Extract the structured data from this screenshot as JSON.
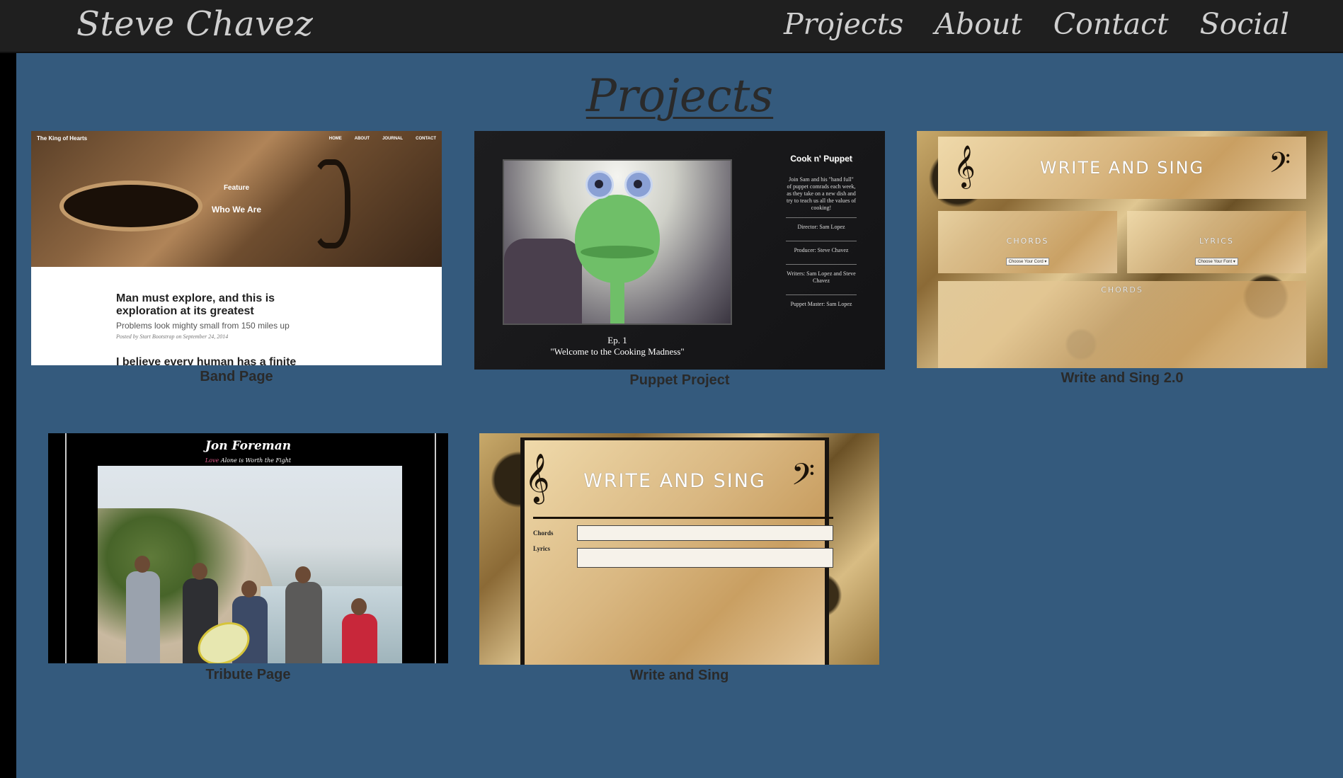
{
  "header": {
    "brand": "Steve Chavez",
    "nav": [
      "Projects",
      "About",
      "Contact",
      "Social"
    ]
  },
  "main": {
    "title": "Projects"
  },
  "projects": [
    {
      "caption": "Band Page",
      "site_title": "The King of Hearts",
      "site_nav": [
        "HOME",
        "ABOUT",
        "JOURNAL",
        "CONTACT"
      ],
      "hero_small": "Feature",
      "hero_large": "Who We Are",
      "headline": "Man must explore, and this is exploration at its greatest",
      "subline": "Problems look mighty small from 150 miles up",
      "meta": "Posted by Start Bootstrap on September 24, 2014",
      "cut_text": "I believe every human has a finite"
    },
    {
      "caption": "Puppet Project",
      "logo": "Cook n' Puppet",
      "blurb": "Join Sam and his \"hand full\" of puppet comrads each week, as they take on a new dish and try to teach us all the values of cooking!",
      "credits": [
        "Director: Sam Lopez",
        "Producer: Steve Chavez",
        "Writers: Sam Lopez and Steve Chavez",
        "Puppet Master: Sam Lopez"
      ],
      "episode": "Ep. 1",
      "episode_title": "\"Welcome to the Cooking Madness\""
    },
    {
      "caption": "Write and Sing 2.0",
      "title": "WRITE AND SING",
      "panels": [
        "CHORDS",
        "LYRICS"
      ],
      "select_chords": "Choose Your Cord ▾",
      "select_lyrics": "Choose Your Font ▾",
      "bottom_panel": "CHORDS"
    },
    {
      "caption": "Tribute Page",
      "name": "Jon Foreman",
      "tagline_love": "Love",
      "tagline_rest": "Alone is Worth the Fight"
    },
    {
      "caption": "Write and Sing",
      "title": "WRITE AND SING",
      "label_chords": "Chords",
      "label_lyrics": "Lyrics"
    }
  ]
}
